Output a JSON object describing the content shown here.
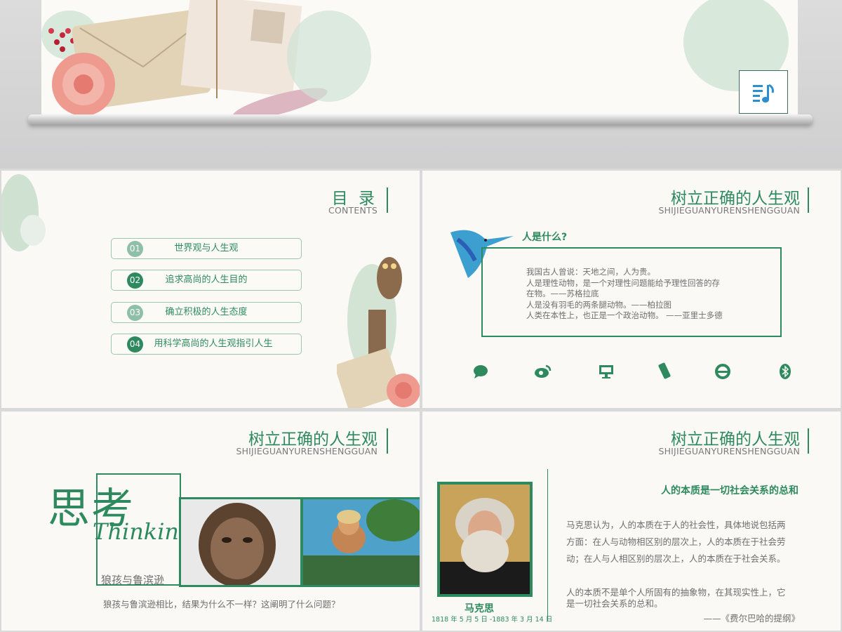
{
  "hero": {
    "music_icon": "music-playlist-icon"
  },
  "slide_contents": {
    "title": "目 录",
    "subtitle": "CONTENTS",
    "items": [
      {
        "num": "01",
        "label": "世界观与人生观",
        "color": "#8fbfa8"
      },
      {
        "num": "02",
        "label": "追求高尚的人生目的",
        "color": "#2e8a5e"
      },
      {
        "num": "03",
        "label": "确立积极的人生态度",
        "color": "#8fbfa8"
      },
      {
        "num": "04",
        "label": "用科学高尚的人生观指引人生",
        "color": "#2e8a5e"
      }
    ]
  },
  "slide_what_is_man": {
    "title": "树立正确的人生观",
    "subtitle": "SHIJIEGUANYURENSHENGGUAN",
    "heading": "人是什么?",
    "lines": [
      "我国古人曾说：天地之间，人为贵。",
      "人是理性动物，是一个对理性问题能给予理性回答的存",
      "在物。——苏格拉底",
      "人是没有羽毛的两条腿动物。——柏拉图",
      "人类在本性上，也正是一个政治动物。 ——亚里士多德"
    ],
    "icons": [
      "chat-icon",
      "weibo-icon",
      "monitor-icon",
      "phone-icon",
      "ie-icon",
      "bluetooth-icon"
    ]
  },
  "slide_think": {
    "title": "树立正确的人生观",
    "subtitle": "SHIJIEGUANYURENSHENGGUAN",
    "big_cn": "思考",
    "big_en": "Thinkin",
    "caption": "狼孩与鲁滨逊",
    "question": "狼孩与鲁滨逊相比，结果为什么不一样？这阐明了什么问题？"
  },
  "slide_marx": {
    "title": "树立正确的人生观",
    "subtitle": "SHIJIEGUANYURENSHENGGUAN",
    "name": "马克思",
    "dates": "1818 年 5 月 5 日 -1883 年 3 月 14 日",
    "heading": "人的本质是一切社会关系的总和",
    "para1": [
      "马克思认为，人的本质在于人的社会性，具体地说包括两",
      "方面：在人与动物相区别的层次上，人的本质在于社会劳",
      "动；在人与人相区别的层次上，人的本质在于社会关系。"
    ],
    "para2": [
      "人的本质不是单个人所固有的抽象物，在其现实性上，它",
      "是一切社会关系的总和。"
    ],
    "source": "——《费尔巴哈的提纲》"
  },
  "colors": {
    "accent": "#2e8a5e",
    "light_accent": "#8fbfa8"
  }
}
